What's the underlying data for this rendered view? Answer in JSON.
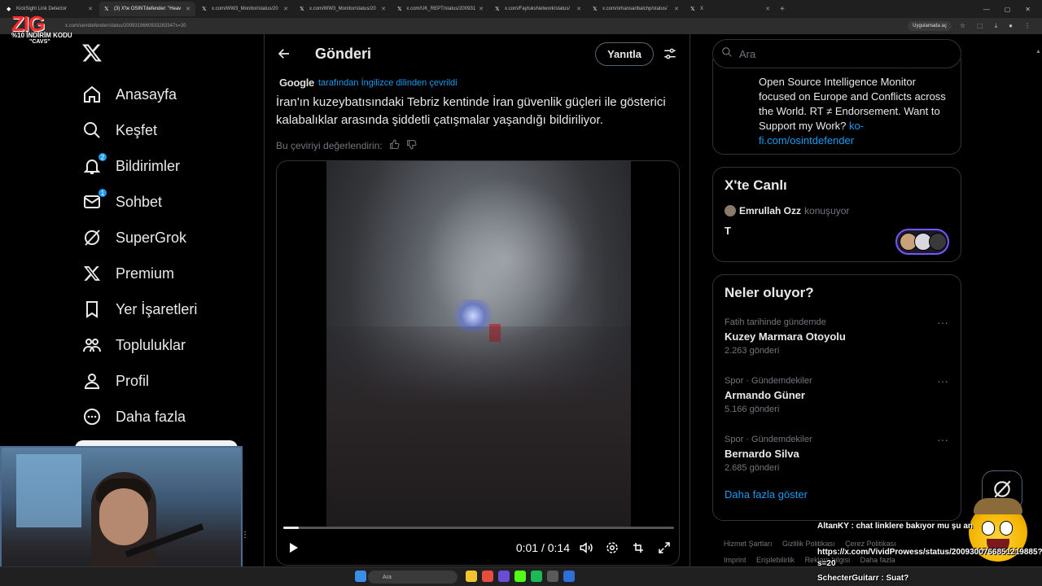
{
  "browser": {
    "tabs": [
      {
        "title": "KickSight Link Detector",
        "active": false
      },
      {
        "title": "(3) X'te OSINTdefender: \"Heav",
        "active": true
      },
      {
        "title": "x.com/WW3_Monitor/status/20",
        "active": false
      },
      {
        "title": "x.com/WW3_Monitor/status/20",
        "active": false
      },
      {
        "title": "x.com/UK_REPT/status/200931",
        "active": false
      },
      {
        "title": "x.com/FaytuksNetwork/status/",
        "active": false
      },
      {
        "title": "x.com/orhansaribalchp/status/",
        "active": false
      },
      {
        "title": "X",
        "active": false
      }
    ],
    "url": "x.com/sentdefender/status/2009319660933283347s=20",
    "open_in_app": "Uygulamada aç"
  },
  "overlay_logo": {
    "big": "ZIG",
    "code": "%10 İNDİRİM KODU",
    "code2": "\"CAVS\""
  },
  "nav": {
    "items": [
      {
        "label": "Anasayfa",
        "icon": "home-icon"
      },
      {
        "label": "Keşfet",
        "icon": "search-icon"
      },
      {
        "label": "Bildirimler",
        "icon": "bell-icon",
        "badge": "2"
      },
      {
        "label": "Sohbet",
        "icon": "mail-icon",
        "badge": "1"
      },
      {
        "label": "SuperGrok",
        "icon": "grok-icon"
      },
      {
        "label": "Premium",
        "icon": "x-icon"
      },
      {
        "label": "Yer İşaretleri",
        "icon": "bookmark-icon"
      },
      {
        "label": "Topluluklar",
        "icon": "people-icon"
      },
      {
        "label": "Profil",
        "icon": "person-icon"
      },
      {
        "label": "Daha fazla",
        "icon": "more-circle-icon"
      }
    ]
  },
  "post": {
    "header_title": "Gönderi",
    "reply_label": "Yanıtla",
    "translation_brand": "Google",
    "translation_note": "tarafından İngilizce dilinden çevrildi",
    "text": "İran'ın kuzeybatısındaki Tebriz kentinde İran güvenlik güçleri ile gösterici kalabalıklar arasında şiddetli çatışmalar yaşandığı bildiriliyor.",
    "rate_translation": "Bu çeviriyi değerlendirin:",
    "video": {
      "time": "0:01 / 0:14",
      "progress": 0.04
    }
  },
  "right": {
    "search_placeholder": "Ara",
    "bio_text": "Open Source Intelligence Monitor focused on Europe and Conflicts across the World. RT ≠ Endorsement. Want to Support my Work?",
    "bio_link": "ko-fi.com/osintdefender",
    "live": {
      "title": "X'te Canlı",
      "host": "Emrullah Ozz",
      "status": "konuşuyor",
      "space_title": "T"
    },
    "trends": {
      "title": "Neler oluyor?",
      "items": [
        {
          "meta": "Fatih tarihinde gündemde",
          "name": "Kuzey Marmara Otoyolu",
          "count": "2.263 gönderi"
        },
        {
          "meta": "Spor · Gündemdekiler",
          "name": "Armando Güner",
          "count": "5.166 gönderi"
        },
        {
          "meta": "Spor · Gündemdekiler",
          "name": "Bernardo Silva",
          "count": "2.685 gönderi"
        }
      ],
      "show_more": "Daha fazla göster"
    },
    "footer": [
      "Hizmet Şartları",
      "Gizlilik Politikası",
      "Çerez Politikası",
      "Imprint",
      "Erişilebilirlik",
      "Reklam bilgisi",
      "Daha fazla"
    ]
  },
  "chat": [
    {
      "user": "AltanKY",
      "msg": "chat linklere bakıyor mu şu an"
    },
    {
      "user": "",
      "msg": "https://x.com/VividProwess/status/2009300766851219885?"
    },
    {
      "user": "",
      "msg": "s=20"
    },
    {
      "user": "SchecterGuitarr",
      "msg": "Suat?"
    }
  ],
  "taskbar": {
    "search_label": "Ara"
  },
  "colors": {
    "accent": "#1d9bf0",
    "background": "#000000",
    "border": "#2f3336",
    "muted": "#71767b"
  }
}
